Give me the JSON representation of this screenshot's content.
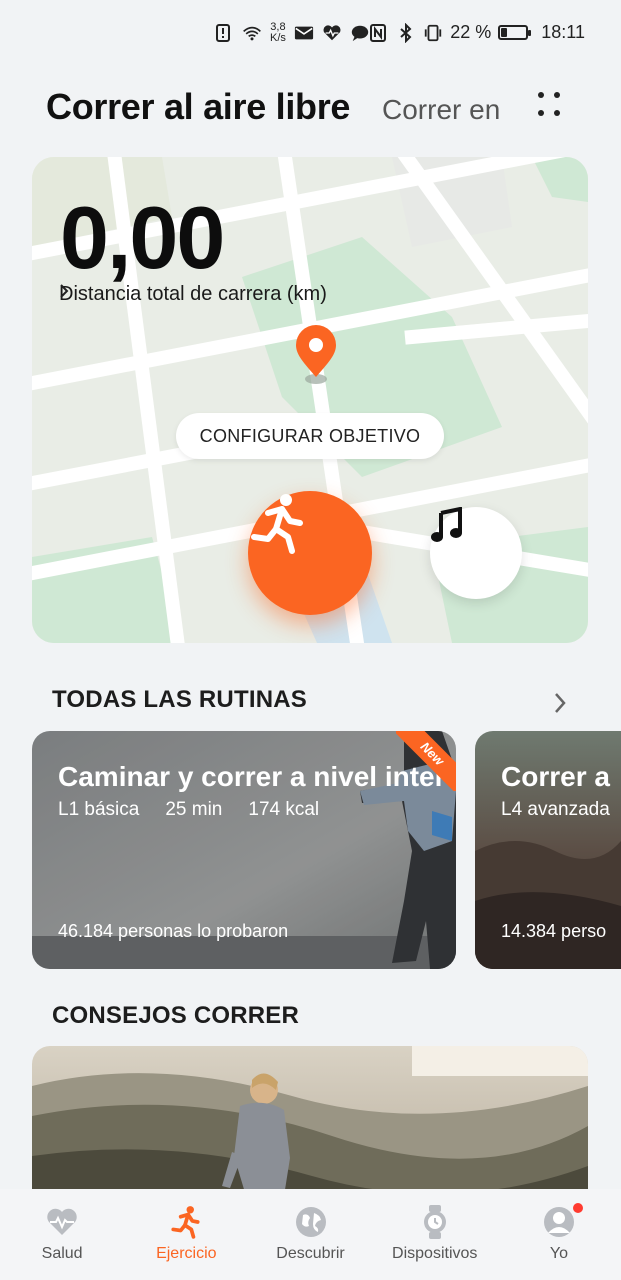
{
  "status_bar": {
    "speed_value": "3,8",
    "speed_unit": "K/s",
    "battery_percent": "22 %",
    "battery_level": 0.22,
    "time": "18:11",
    "left_icons": [
      "alert-icon",
      "wifi-icon",
      "mail-icon",
      "heart-monitor-icon",
      "chat-icon"
    ],
    "right_icons": [
      "nfc-icon",
      "bluetooth-icon",
      "vibrate-icon",
      "battery-icon"
    ]
  },
  "header": {
    "title": "Correr al aire libre",
    "secondary_tab": "Correr en"
  },
  "map_card": {
    "distance_value": "0,00",
    "distance_label": "Distancia total de carrera (km)",
    "goal_button": "CONFIGURAR OBJETIVO",
    "colors": {
      "accent": "#fb6522",
      "map_base": "#e9ede6",
      "map_green": "#cfe8d4",
      "map_road": "#ffffff",
      "map_water": "#cfe3ef"
    }
  },
  "routines": {
    "section_title": "TODAS LAS RUTINAS",
    "cards": [
      {
        "title": "Caminar y correr a nivel inter…",
        "level": "L1 básica",
        "duration": "25 min",
        "calories": "174 kcal",
        "people": "46.184 personas lo probaron",
        "badge": "New"
      },
      {
        "title": "Correr a",
        "level": "L4 avanzada",
        "people": "14.384 perso"
      }
    ]
  },
  "tips": {
    "section_title": "CONSEJOS CORRER"
  },
  "bottom_nav": {
    "items": [
      {
        "label": "Salud",
        "icon": "heart-icon",
        "active": false
      },
      {
        "label": "Ejercicio",
        "icon": "running-icon",
        "active": true
      },
      {
        "label": "Descubrir",
        "icon": "globe-icon",
        "active": false
      },
      {
        "label": "Dispositivos",
        "icon": "watch-icon",
        "active": false
      },
      {
        "label": "Yo",
        "icon": "profile-icon",
        "active": false,
        "notification": true
      }
    ]
  }
}
